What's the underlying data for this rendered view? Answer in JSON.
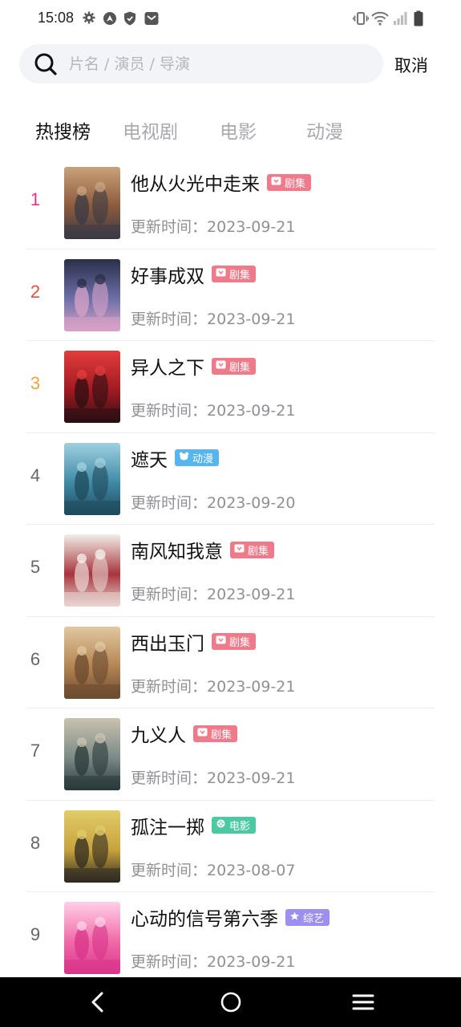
{
  "status_bar": {
    "time": "15:08"
  },
  "search": {
    "placeholder": "片名 / 演员 / 导演",
    "value": "",
    "cancel_label": "取消"
  },
  "tabs": [
    {
      "label": "热搜榜",
      "active": true
    },
    {
      "label": "电视剧",
      "active": false
    },
    {
      "label": "电影",
      "active": false
    },
    {
      "label": "动漫",
      "active": false
    }
  ],
  "update_prefix": "更新时间：",
  "ranking": [
    {
      "rank": "1",
      "title": "他从火光中走来",
      "badge": "剧集",
      "badge_type": "drama",
      "date": "2023-09-21"
    },
    {
      "rank": "2",
      "title": "好事成双",
      "badge": "剧集",
      "badge_type": "drama",
      "date": "2023-09-21"
    },
    {
      "rank": "3",
      "title": "异人之下",
      "badge": "剧集",
      "badge_type": "drama",
      "date": "2023-09-21"
    },
    {
      "rank": "4",
      "title": "遮天",
      "badge": "动漫",
      "badge_type": "anime",
      "date": "2023-09-20"
    },
    {
      "rank": "5",
      "title": "南风知我意",
      "badge": "剧集",
      "badge_type": "drama",
      "date": "2023-09-21"
    },
    {
      "rank": "6",
      "title": "西出玉门",
      "badge": "剧集",
      "badge_type": "drama",
      "date": "2023-09-21"
    },
    {
      "rank": "7",
      "title": "九义人",
      "badge": "剧集",
      "badge_type": "drama",
      "date": "2023-09-21"
    },
    {
      "rank": "8",
      "title": "孤注一掷",
      "badge": "电影",
      "badge_type": "movie",
      "date": "2023-08-07"
    },
    {
      "rank": "9",
      "title": "心动的信号第六季",
      "badge": "综艺",
      "badge_type": "variety",
      "date": "2023-09-21"
    }
  ],
  "colors": {
    "rank_1": "#e4358a",
    "rank_2": "#e0513f",
    "rank_3": "#f0a33a",
    "rank_default": "#666666",
    "badge_drama": "#ef7b8a",
    "badge_anime": "#56b4ee",
    "badge_movie": "#4cc9a0",
    "badge_variety": "#9d8ff0"
  },
  "posters": [
    {
      "colors": [
        "#3a3a45",
        "#8b5a3c",
        "#c9a27a"
      ],
      "icon": "poster-1"
    },
    {
      "colors": [
        "#d9a3c7",
        "#6d6fa8",
        "#2a2f4a"
      ],
      "icon": "poster-2"
    },
    {
      "colors": [
        "#2b0f12",
        "#a11a22",
        "#e23c3c"
      ],
      "icon": "poster-3"
    },
    {
      "colors": [
        "#1f4a5c",
        "#3f8aa6",
        "#9fd0e0"
      ],
      "icon": "poster-4"
    },
    {
      "colors": [
        "#e7d3cf",
        "#a8343c",
        "#f2eee8"
      ],
      "icon": "poster-5"
    },
    {
      "colors": [
        "#6b4a30",
        "#b48552",
        "#e2c7a0"
      ],
      "icon": "poster-6"
    },
    {
      "colors": [
        "#2a3a3a",
        "#7b8a86",
        "#c9c2b0"
      ],
      "icon": "poster-7"
    },
    {
      "colors": [
        "#2e2a22",
        "#c8a23c",
        "#e0cc6a"
      ],
      "icon": "poster-8"
    },
    {
      "colors": [
        "#d9348a",
        "#f06aa8",
        "#ffd0e6"
      ],
      "icon": "poster-9"
    }
  ]
}
